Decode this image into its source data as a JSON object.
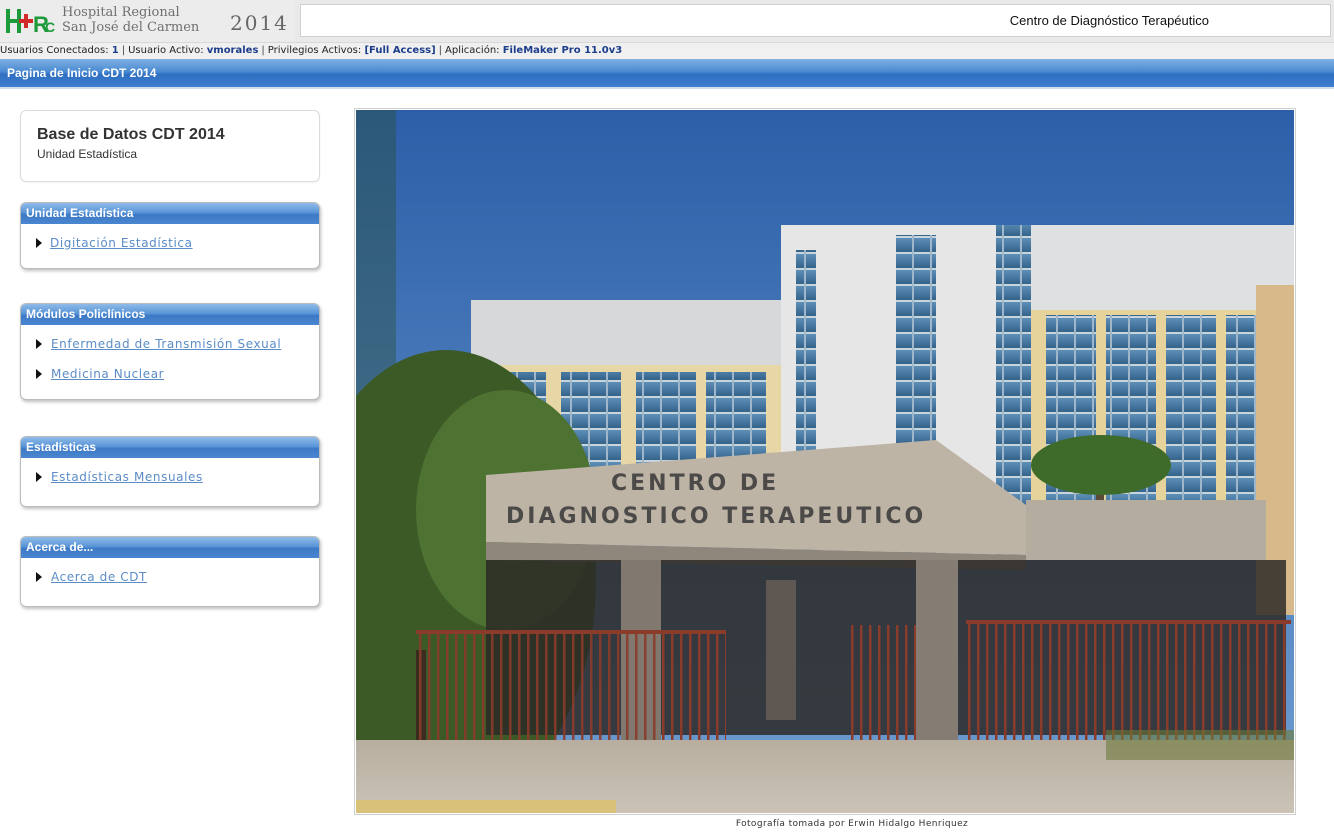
{
  "header": {
    "logo_text": "H+RC",
    "hospital_line1": "Hospital Regional",
    "hospital_line2": "San José del Carmen",
    "year": "2014",
    "center_title": "Centro de Diagnóstico Terapéutico"
  },
  "status": {
    "users_label": "Usuarios Conectados:",
    "users_value": "1",
    "active_user_label": "Usuario Activo:",
    "active_user_value": "vmorales",
    "privileges_label": "Privilegios Activos:",
    "privileges_value": "[Full Access]",
    "app_label": "Aplicación:",
    "app_value": "FileMaker Pro 11.0v3"
  },
  "page": {
    "title": "Pagina de Inicio CDT 2014"
  },
  "database": {
    "title": "Base de Datos CDT 2014",
    "subtitle": "Unidad Estadística"
  },
  "panels": [
    {
      "title": "Unidad Estadística",
      "items": [
        {
          "label": "Digitación Estadística"
        }
      ]
    },
    {
      "title": "Módulos Policlínicos",
      "items": [
        {
          "label": "Enfermedad de Transmisión Sexual"
        },
        {
          "label": "Medicina Nuclear"
        }
      ]
    },
    {
      "title": "Estadísticas",
      "items": [
        {
          "label": "Estadísticas Mensuales"
        }
      ]
    },
    {
      "title": "Acerca de...",
      "items": [
        {
          "label": "Acerca de CDT"
        }
      ]
    }
  ],
  "photo": {
    "sign_line1": "CENTRO DE",
    "sign_line2": "DIAGNOSTICO TERAPEUTICO",
    "caption": "Fotografía tomada por Erwin Hidalgo Henriquez"
  },
  "colors": {
    "header_blue": "#3f7fcf",
    "link": "#5b8cc6",
    "logo_green": "#1d9a3a",
    "logo_red": "#d22a2a"
  }
}
